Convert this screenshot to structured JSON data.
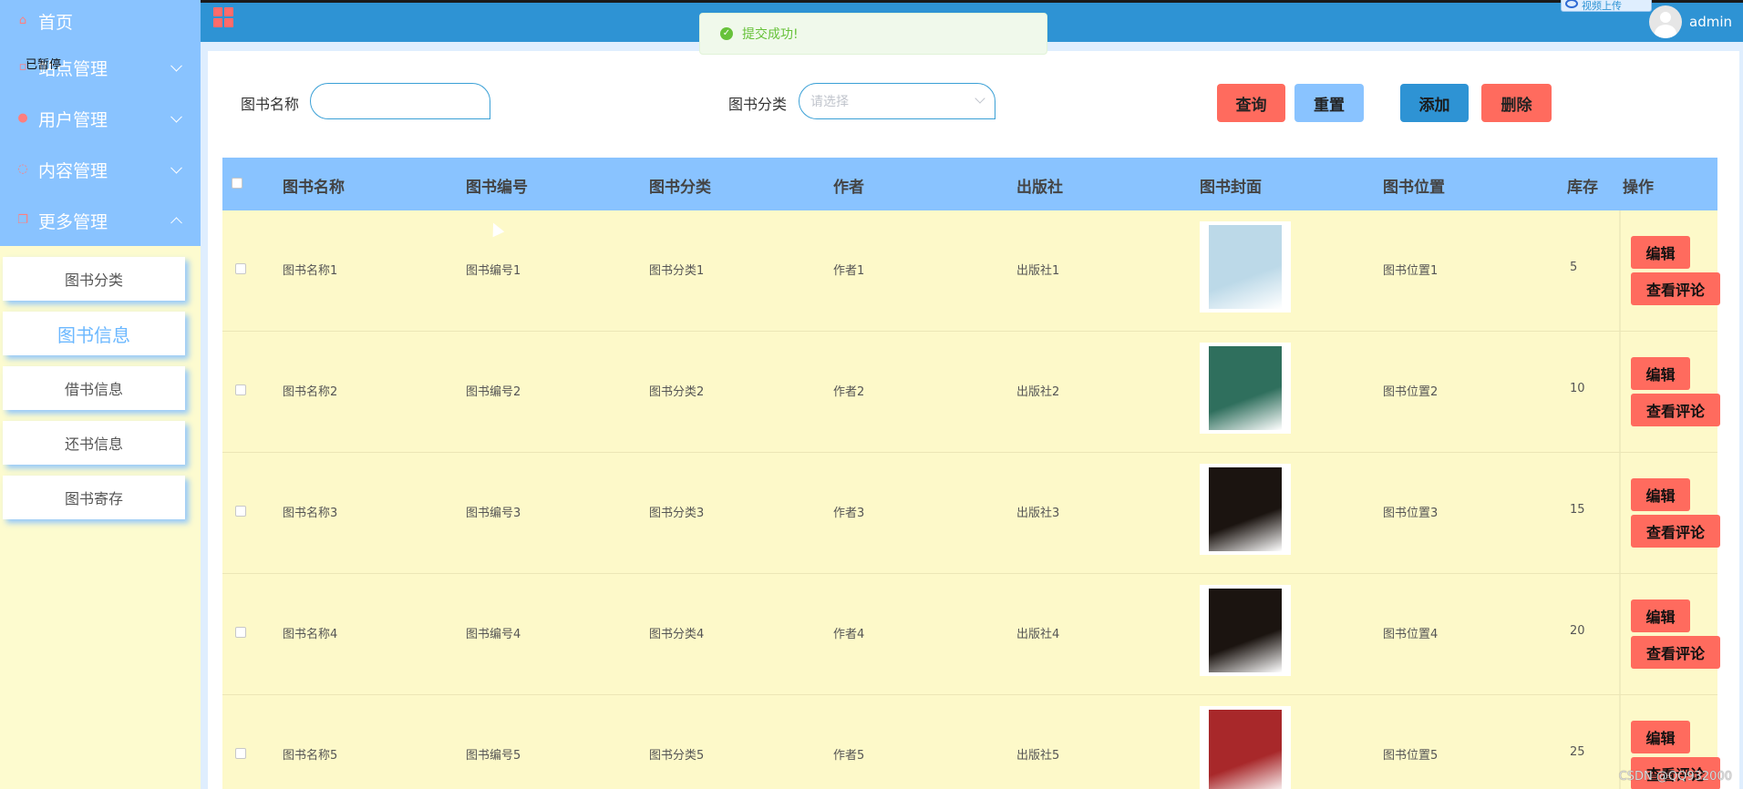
{
  "sidebar": {
    "items": [
      {
        "label": "首页",
        "icon": "home-icon"
      },
      {
        "label": "站点管理",
        "icon": "cart-icon"
      },
      {
        "label": "用户管理",
        "icon": "user-icon"
      },
      {
        "label": "内容管理",
        "icon": "chat-icon"
      },
      {
        "label": "更多管理",
        "icon": "copy-icon"
      }
    ],
    "paused_label": "已暂停",
    "sub_items": [
      "图书分类",
      "图书信息",
      "借书信息",
      "还书信息",
      "图书寄存"
    ],
    "active_sub": "图书信息"
  },
  "header": {
    "username": "admin",
    "upload_chip": "视频上传"
  },
  "toast": {
    "message": "提交成功!"
  },
  "search": {
    "name_label": "图书名称",
    "name_value": "",
    "category_label": "图书分类",
    "category_placeholder": "请选择",
    "query_label": "查询",
    "reset_label": "重置",
    "add_label": "添加",
    "delete_label": "删除"
  },
  "table": {
    "columns": [
      "图书名称",
      "图书编号",
      "图书分类",
      "作者",
      "出版社",
      "图书封面",
      "图书位置",
      "库存",
      "操作"
    ],
    "edit_label": "编辑",
    "review_label": "查看评论",
    "rows": [
      {
        "name": "图书名称1",
        "code": "图书编号1",
        "category": "图书分类1",
        "author": "作者1",
        "publisher": "出版社1",
        "location": "图书位置1",
        "stock": "5",
        "cover_color": "#bcd9e8"
      },
      {
        "name": "图书名称2",
        "code": "图书编号2",
        "category": "图书分类2",
        "author": "作者2",
        "publisher": "出版社2",
        "location": "图书位置2",
        "stock": "10",
        "cover_color": "#2f6f5d"
      },
      {
        "name": "图书名称3",
        "code": "图书编号3",
        "category": "图书分类3",
        "author": "作者3",
        "publisher": "出版社3",
        "location": "图书位置3",
        "stock": "15",
        "cover_color": "#1b1410"
      },
      {
        "name": "图书名称4",
        "code": "图书编号4",
        "category": "图书分类4",
        "author": "作者4",
        "publisher": "出版社4",
        "location": "图书位置4",
        "stock": "20",
        "cover_color": "#1b1410"
      },
      {
        "name": "图书名称5",
        "code": "图书编号5",
        "category": "图书分类5",
        "author": "作者5",
        "publisher": "出版社5",
        "location": "图书位置5",
        "stock": "25",
        "cover_color": "#a8282a"
      }
    ]
  },
  "watermark": "CSDN @QQ932000",
  "colors": {
    "header": "#2e93d4",
    "sidebar": "#89c3ff",
    "row": "#fdf9c9",
    "danger": "#ff6b5e"
  }
}
